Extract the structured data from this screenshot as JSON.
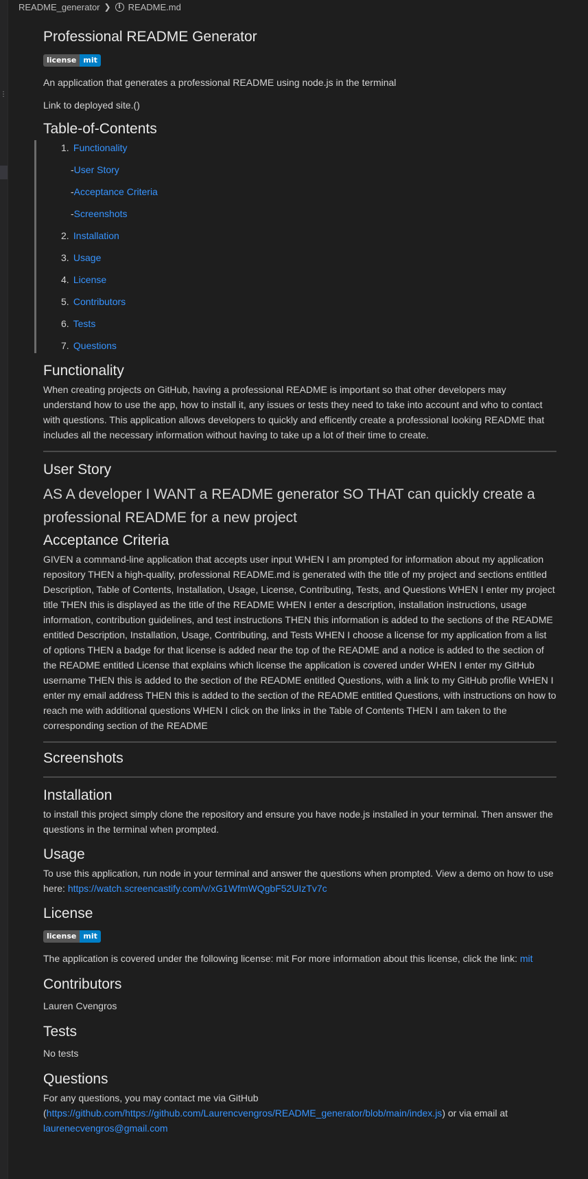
{
  "breadcrumb": {
    "folder": "README_generator",
    "file": "README.md"
  },
  "readme": {
    "title": "Professional README Generator",
    "badge": {
      "left": "license",
      "right": "mit"
    },
    "description": "An application that generates a professional README using node.js in the terminal",
    "deployed_link": "Link to deployed site.()",
    "toc": {
      "heading": "Table-of-Contents",
      "items": [
        {
          "number": "1.",
          "label": "Functionality"
        },
        {
          "prefix": "-",
          "label": "User Story"
        },
        {
          "prefix": "-",
          "label": "Acceptance Criteria"
        },
        {
          "prefix": "-",
          "label": "Screenshots"
        },
        {
          "number": "2.",
          "label": "Installation"
        },
        {
          "number": "3.",
          "label": "Usage"
        },
        {
          "number": "4.",
          "label": "License"
        },
        {
          "number": "5.",
          "label": "Contributors"
        },
        {
          "number": "6.",
          "label": "Tests"
        },
        {
          "number": "7.",
          "label": "Questions"
        }
      ]
    },
    "functionality": {
      "heading": "Functionality",
      "text": "When creating projects on GitHub, having a professional README is important so that other developers may understand how to use the app, how to install it, any issues or tests they need to take into account and who to contact with questions. This application allows developers to quickly and efficently create a professional looking README that includes all the necessary information without having to take up a lot of their time to create."
    },
    "user_story": {
      "heading": "User Story",
      "text": "AS A developer I WANT a README generator SO THAT can quickly create a professional README for a new project"
    },
    "acceptance": {
      "heading": "Acceptance Criteria",
      "text": "GIVEN a command-line application that accepts user input WHEN I am prompted for information about my application repository THEN a high-quality, professional README.md is generated with the title of my project and sections entitled Description, Table of Contents, Installation, Usage, License, Contributing, Tests, and Questions WHEN I enter my project title THEN this is displayed as the title of the README WHEN I enter a description, installation instructions, usage information, contribution guidelines, and test instructions THEN this information is added to the sections of the README entitled Description, Installation, Usage, Contributing, and Tests WHEN I choose a license for my application from a list of options THEN a badge for that license is added near the top of the README and a notice is added to the section of the README entitled License that explains which license the application is covered under WHEN I enter my GitHub username THEN this is added to the section of the README entitled Questions, with a link to my GitHub profile WHEN I enter my email address THEN this is added to the section of the README entitled Questions, with instructions on how to reach me with additional questions WHEN I click on the links in the Table of Contents THEN I am taken to the corresponding section of the README"
    },
    "screenshots": {
      "heading": "Screenshots"
    },
    "installation": {
      "heading": "Installation",
      "text": "to install this project simply clone the repository and ensure you have node.js installed in your terminal. Then answer the questions in the terminal when prompted."
    },
    "usage": {
      "heading": "Usage",
      "text": "To use this application, run node in your terminal and answer the questions when prompted. View a demo on how to use here:",
      "link": "https://watch.screencastify.com/v/xG1WfmWQgbF52UIzTv7c"
    },
    "license": {
      "heading": "License",
      "text": "The application is covered under the following license: mit For more information about this license, click the link:",
      "link": "mit"
    },
    "contributors": {
      "heading": "Contributors",
      "text": "Lauren Cvengros"
    },
    "tests": {
      "heading": "Tests",
      "text": "No tests"
    },
    "questions": {
      "heading": "Questions",
      "text_before": "For any questions, you may contact me via GitHub",
      "open_paren": "(",
      "github_link": "https://github.com/https://github.com/Laurencvengros/README_generator/blob/main/index.js",
      "text_after": ") or via email at",
      "email": "laurenecvengros@gmail.com"
    }
  },
  "colors": {
    "background": "#1e1e1e",
    "text": "#d4d4d4",
    "link": "#3794ff",
    "badge_left": "#555555",
    "badge_right": "#007ec6"
  }
}
